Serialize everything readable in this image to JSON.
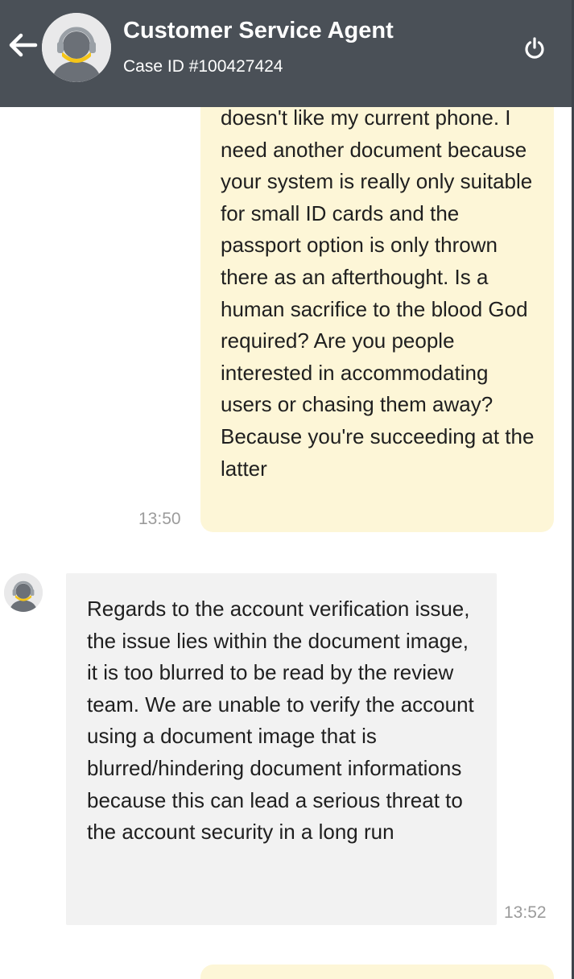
{
  "header": {
    "back_icon": "arrow-left-icon",
    "avatar_icon": "support-agent-avatar",
    "title": "Customer Service Agent",
    "subtitle": "Case ID #100427424",
    "power_icon": "power-icon"
  },
  "messages": [
    {
      "sender": "user",
      "text": "doesn't like my current phone. I need another document because your system is really only suitable for small ID cards and the passport option is only thrown there as an afterthought. Is a human sacrifice to the blood God required? Are you people interested in accommodating users or chasing them away? Because you're succeeding at the latter",
      "time": "13:50"
    },
    {
      "sender": "agent",
      "text": "Regards to the account verification issue, the issue lies within the document image, it is too blurred to be read by the review team. We are unable to verify the account using a document image that is blurred/hindering document informations because this can lead a serious threat to the account security in a long run",
      "time": "13:52"
    },
    {
      "sender": "user",
      "text": ""
    }
  ],
  "colors": {
    "header_bg": "#4a5057",
    "user_bubble": "#fdf6d7",
    "agent_bubble": "#f2f2f2",
    "avatar_accent": "#f5c518",
    "timestamp": "#9b9b9b"
  }
}
